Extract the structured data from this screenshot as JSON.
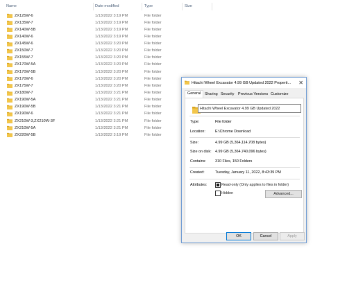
{
  "columns": {
    "name": "Name",
    "date": "Date modified",
    "type": "Type",
    "size": "Size"
  },
  "files": [
    {
      "name": "ZX125W-6",
      "date": "1/13/2022 3:19 PM",
      "type": "File folder"
    },
    {
      "name": "ZX135W-7",
      "date": "1/13/2022 3:19 PM",
      "type": "File folder"
    },
    {
      "name": "ZX140W-5B",
      "date": "1/13/2022 3:19 PM",
      "type": "File folder"
    },
    {
      "name": "ZX140W-6",
      "date": "1/13/2022 3:19 PM",
      "type": "File folder"
    },
    {
      "name": "ZX145W-6",
      "date": "1/13/2022 3:20 PM",
      "type": "File folder"
    },
    {
      "name": "ZX150W-7",
      "date": "1/13/2022 3:20 PM",
      "type": "File folder"
    },
    {
      "name": "ZX155W-7",
      "date": "1/13/2022 3:20 PM",
      "type": "File folder"
    },
    {
      "name": "ZX170W-5A",
      "date": "1/13/2022 3:20 PM",
      "type": "File folder"
    },
    {
      "name": "ZX170W-5B",
      "date": "1/13/2022 3:20 PM",
      "type": "File folder"
    },
    {
      "name": "ZX170W-6",
      "date": "1/13/2022 3:20 PM",
      "type": "File folder"
    },
    {
      "name": "ZX175W-7",
      "date": "1/13/2022 3:20 PM",
      "type": "File folder"
    },
    {
      "name": "ZX180W-7",
      "date": "1/13/2022 3:21 PM",
      "type": "File folder"
    },
    {
      "name": "ZX190W-5A",
      "date": "1/13/2022 3:21 PM",
      "type": "File folder"
    },
    {
      "name": "ZX190W-5B",
      "date": "1/13/2022 3:21 PM",
      "type": "File folder"
    },
    {
      "name": "ZX190W-6",
      "date": "1/13/2022 3:21 PM",
      "type": "File folder"
    },
    {
      "name": "ZX210W-3,ZX210W-3F",
      "date": "1/13/2022 3:21 PM",
      "type": "File folder"
    },
    {
      "name": "ZX210W-5A",
      "date": "1/13/2022 3:21 PM",
      "type": "File folder"
    },
    {
      "name": "ZX220W-5B",
      "date": "1/13/2022 3:19 PM",
      "type": "File folder"
    }
  ],
  "dialog": {
    "title": "Hitachi Wheel Excavator 4.99 GB Updated 2022 Properti...",
    "close_glyph": "✕",
    "tabs": [
      "General",
      "Sharing",
      "Security",
      "Previous Versions",
      "Customize"
    ],
    "folder_name": "Hitachi Wheel Excavator 4.99 GB Updated 2022",
    "type_label": "Type:",
    "type_value": "File folder",
    "location_label": "Location:",
    "location_value": "E:\\Chrome Download",
    "size_label": "Size:",
    "size_value": "4.99 GB (5,364,114,708 bytes)",
    "size_on_disk_label": "Size on disk:",
    "size_on_disk_value": "4.99 GB (5,364,740,096 bytes)",
    "contains_label": "Contains:",
    "contains_value": "310 Files, 150 Folders",
    "created_label": "Created:",
    "created_value": "Tuesday, January 11, 2022, 8:43:39 PM",
    "attributes_label": "Attributes:",
    "readonly_label": "Read-only (Only applies to files in folder)",
    "readonly_checked": true,
    "hidden_label": "Hidden",
    "hidden_checked": false,
    "advanced_label": "Advanced...",
    "ok_label": "OK",
    "cancel_label": "Cancel",
    "apply_label": "Apply"
  },
  "colors": {
    "folder": "#f3c64a",
    "folder_dark": "#d9a520",
    "accent": "#0078d7"
  }
}
